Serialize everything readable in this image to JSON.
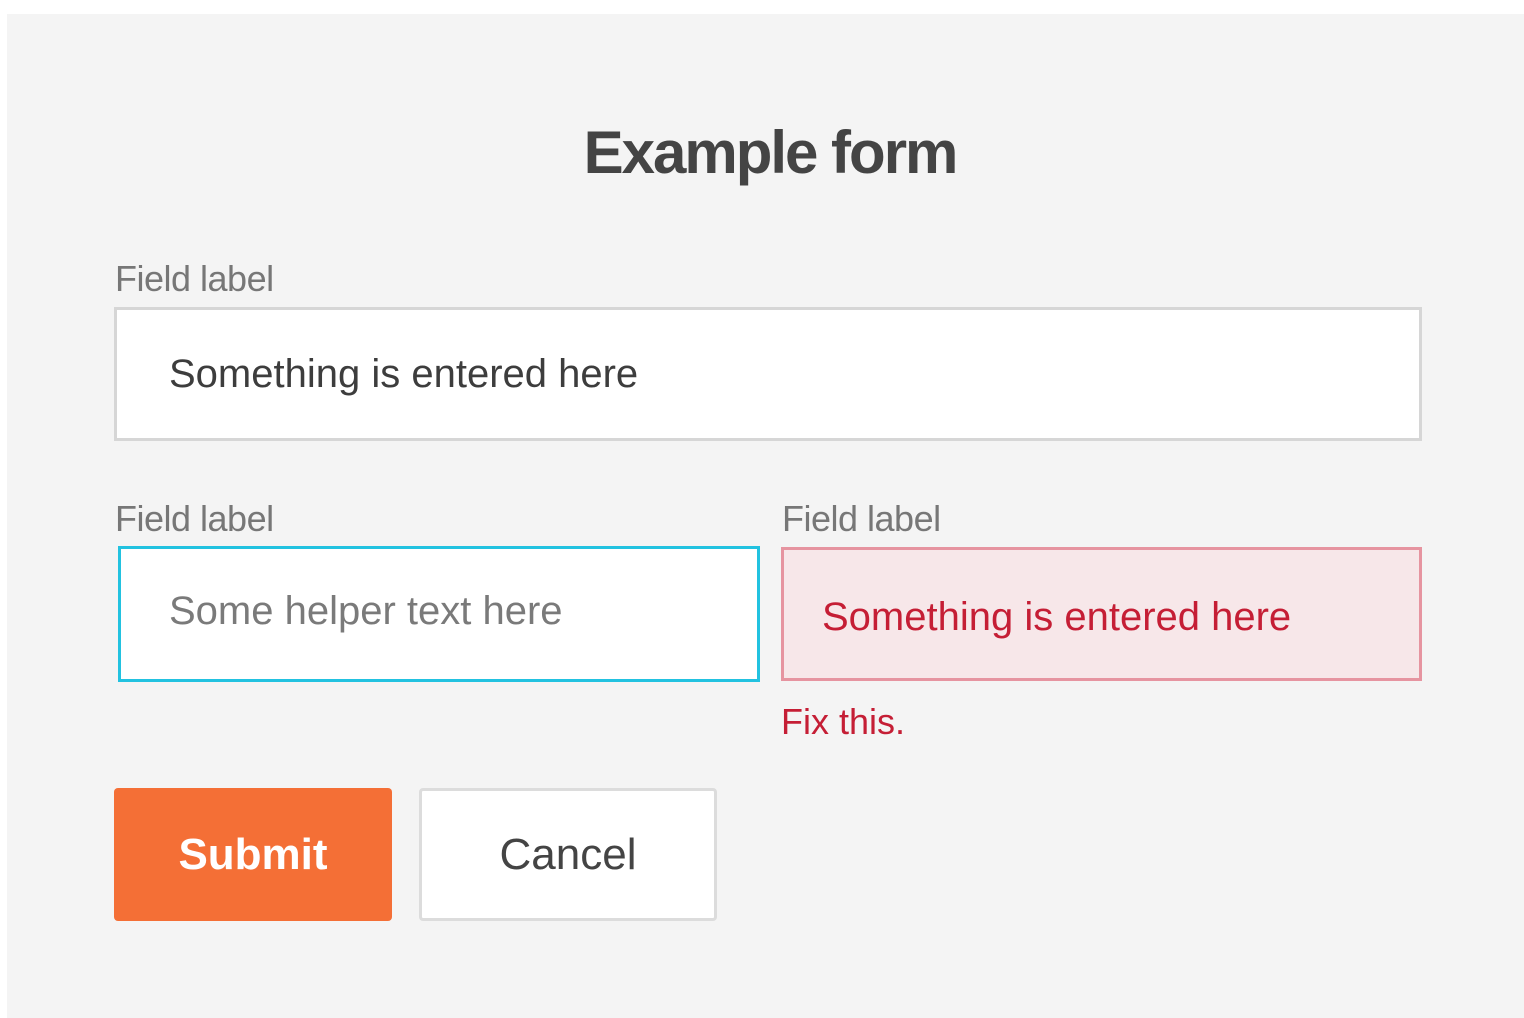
{
  "form": {
    "title": "Example form",
    "field1": {
      "label": "Field label",
      "value": "Something is entered here"
    },
    "field2": {
      "label": "Field label",
      "placeholder": "Some helper text here",
      "state": "focused"
    },
    "field3": {
      "label": "Field label",
      "value": "Something is entered here",
      "state": "error",
      "error_message": "Fix this."
    },
    "buttons": {
      "submit_label": "Submit",
      "cancel_label": "Cancel"
    }
  },
  "colors": {
    "background": "#f4f4f4",
    "accent": "#f46f36",
    "focus": "#22c2e0",
    "error": "#c51e35",
    "error_background": "#f7e7e9"
  }
}
